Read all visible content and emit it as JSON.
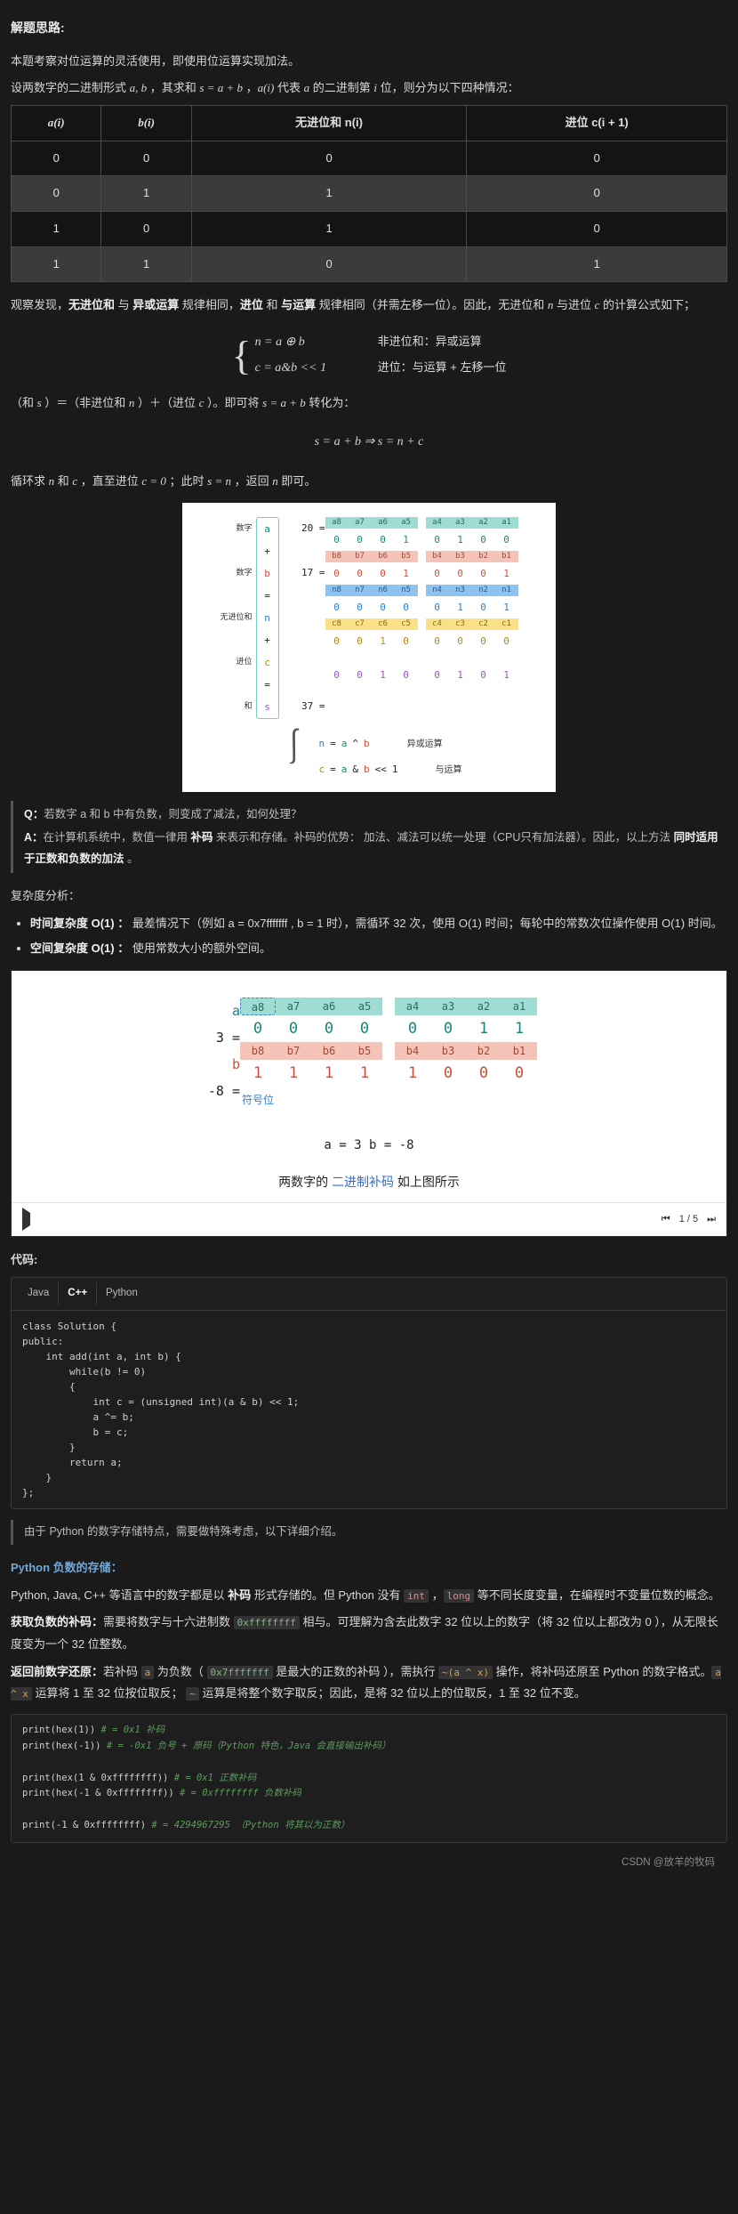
{
  "heading": "解题思路:",
  "intro1": "本题考察对位运算的灵活使用，即使用位运算实现加法。",
  "intro2_parts": {
    "p1": "设两数字的二进制形式 ",
    "m1": "a, b",
    "p2": " ，其求和 ",
    "m2": "s = a + b",
    "p3": " ，",
    "m3": "a(i)",
    "p4": " 代表 ",
    "m4": "a",
    "p5": " 的二进制第 ",
    "m5": "i",
    "p6": " 位，则分为以下四种情况："
  },
  "truth_table": {
    "headers": [
      "a(i)",
      "b(i)",
      "无进位和 n(i)",
      "进位 c(i + 1)"
    ],
    "rows": [
      [
        "0",
        "0",
        "0",
        "0"
      ],
      [
        "0",
        "1",
        "1",
        "0"
      ],
      [
        "1",
        "0",
        "1",
        "0"
      ],
      [
        "1",
        "1",
        "0",
        "1"
      ]
    ]
  },
  "observe_parts": {
    "p1": "观察发现，",
    "b1": "无进位和",
    "p2": " 与 ",
    "b2": "异或运算",
    "p3": " 规律相同，",
    "b3": "进位",
    "p4": " 和 ",
    "b4": "与运算",
    "p5": " 规律相同（并需左移一位）。因此，无进位和 ",
    "m1": "n",
    "p6": " 与进位 ",
    "m2": "c",
    "p7": " 的计算公式如下；"
  },
  "cases": [
    {
      "eq": "n = a ⊕ b",
      "comment": "非进位和：异或运算"
    },
    {
      "eq": "c = a&b << 1",
      "comment": "进位：与运算 + 左移一位"
    }
  ],
  "transform_parts": {
    "p1": "（和 ",
    "m1": "s",
    "p2": " ）＝（非进位和 ",
    "m2": "n",
    "p3": " ）＋（进位 ",
    "m3": "c",
    "p4": " ）。即可将 ",
    "m4": "s = a + b",
    "p5": " 转化为："
  },
  "center_eq": "s = a + b ⇒ s = n + c",
  "loop_parts": {
    "p1": "循环求 ",
    "m1": "n",
    "p2": " 和 ",
    "m2": "c",
    "p3": " ，直至进位 ",
    "m3": "c = 0",
    "p4": " ；此时 ",
    "m4": "s = n",
    "p5": " ，返回 ",
    "m5": "n",
    "p6": " 即可。"
  },
  "figure1": {
    "row_labels": [
      "数字",
      "",
      "数字",
      "",
      "无进位和",
      "",
      "进位",
      "",
      "和"
    ],
    "var_chars": [
      "a",
      "+",
      "b",
      "=",
      "n",
      "+",
      "c",
      "=",
      "s"
    ],
    "decimals": {
      "a": "20",
      "b": "17",
      "s": "37"
    },
    "eq_sign": "=",
    "bit_labels": {
      "a": [
        "a8",
        "a7",
        "a6",
        "a5",
        "a4",
        "a3",
        "a2",
        "a1"
      ],
      "b": [
        "b8",
        "b7",
        "b6",
        "b5",
        "b4",
        "b3",
        "b2",
        "b1"
      ],
      "n": [
        "n8",
        "n7",
        "n6",
        "n5",
        "n4",
        "n3",
        "n2",
        "n1"
      ],
      "c": [
        "c8",
        "c7",
        "c6",
        "c5",
        "c4",
        "c3",
        "c2",
        "c1"
      ]
    },
    "bit_values": {
      "a": [
        "0",
        "0",
        "0",
        "1",
        "0",
        "1",
        "0",
        "0"
      ],
      "b": [
        "0",
        "0",
        "0",
        "1",
        "0",
        "0",
        "0",
        "1"
      ],
      "n": [
        "0",
        "0",
        "0",
        "0",
        "0",
        "1",
        "0",
        "1"
      ],
      "c": [
        "0",
        "0",
        "1",
        "0",
        "0",
        "0",
        "0",
        "0"
      ],
      "s": [
        "0",
        "0",
        "1",
        "0",
        "0",
        "1",
        "0",
        "1"
      ]
    },
    "note_lines": [
      {
        "parts": [
          "n",
          "=",
          "a",
          "^",
          "b"
        ],
        "tail": "异或运算"
      },
      {
        "parts": [
          "c",
          "=",
          "a",
          "&",
          "b",
          "<<",
          "1"
        ],
        "tail": "与运算"
      }
    ]
  },
  "qa": {
    "q_label": "Q：",
    "q_text": "若数字 a 和 b 中有负数，则变成了减法，如何处理？",
    "a_label": "A：",
    "a_text_1": "在计算机系统中，数值一律用 ",
    "a_bold_1": "补码",
    "a_text_2": " 来表示和存储。补码的优势： 加法、减法可以统一处理（CPU只有加法器）。因此，以上方法 ",
    "a_bold_2": "同时适用于正数和负数的加法",
    "a_text_3": " 。"
  },
  "complexity": {
    "title": "复杂度分析：",
    "items": [
      {
        "bold": "时间复杂度 O(1) ：",
        "text": " 最差情况下（例如 a = 0x7fffffff , b = 1 时），需循环 32 次，使用 O(1) 时间；每轮中的常数次位操作使用 O(1) 时间。"
      },
      {
        "bold": "空间复杂度 O(1) ：",
        "text": " 使用常数大小的额外空间。"
      }
    ]
  },
  "figure2": {
    "var_a": "a",
    "var_b": "b",
    "dec_a": "3",
    "dec_b": "-8",
    "eq": "=",
    "labels_a": [
      "a8",
      "a7",
      "a6",
      "a5",
      "a4",
      "a3",
      "a2",
      "a1"
    ],
    "labels_b": [
      "b8",
      "b7",
      "b6",
      "b5",
      "b4",
      "b3",
      "b2",
      "b1"
    ],
    "values_a": [
      "0",
      "0",
      "0",
      "0",
      "0",
      "0",
      "1",
      "1"
    ],
    "values_b": [
      "1",
      "1",
      "1",
      "1",
      "1",
      "0",
      "0",
      "0"
    ],
    "sign_label": "符号位",
    "caption_line1": "a = 3      b = -8",
    "caption_prefix": "两数字的 ",
    "caption_link": "二进制补码",
    "caption_suffix": " 如上图所示",
    "page_indicator": "1 / 5"
  },
  "code_section": {
    "title": "代码:",
    "tabs": [
      "Java",
      "C++",
      "Python"
    ],
    "active_tab": "C++",
    "code": "class Solution {\npublic:\n    int add(int a, int b) {\n        while(b != 0)\n        {\n            int c = (unsigned int)(a & b) << 1;\n            a ^= b;\n            b = c;\n        }\n        return a;\n    }\n};"
  },
  "python_note": "由于 Python 的数字存储特点，需要做特殊考虑，以下详细介绍。",
  "python_section": {
    "title": "Python 负数的存储：",
    "p1_a": "Python, Java, C++ 等语言中的数字都是以 ",
    "p1_b": "补码",
    "p1_c": " 形式存储的。但 Python 没有 ",
    "p1_code1": "int",
    "p1_d": " ，",
    "p1_code2": "long",
    "p1_e": " 等不同长度变量，在编程时不变量位数的概念。",
    "h1": "获取负数的补码：",
    "t1_a": "需要将数字与十六进制数 ",
    "t1_code": "0xffffffff",
    "t1_b": " 相与。可理解为含去此数字 32 位以上的数字（将 32 位以上都改为 0 ），从无限长度变为一个 32 位整数。",
    "h2": "返回前数字还原：",
    "t2_a": "若补码 ",
    "t2_code1": "a",
    "t2_b": " 为负数（ ",
    "t2_code2": "0x7fffffff",
    "t2_c": " 是最大的正数的补码 ），需执行 ",
    "t2_code3": "~(a ^ x)",
    "t2_d": " 操作，将补码还原至 Python 的数字格式。",
    "t2_code4": "a ^ x",
    "t2_e": " 运算将 1 至 32 位按位取反； ",
    "t2_code5": "~",
    "t2_f": " 运算是将整个数字取反；因此，是将 32 位以上的位取反，1 至 32 位不变。"
  },
  "example_code": [
    {
      "code": "print(hex(1))",
      "comment": "# = 0x1 补码"
    },
    {
      "code": "print(hex(-1))",
      "comment": "# = -0x1 负号 + 原码（Python 特色，Java 会直接输出补码）"
    },
    {
      "code": "",
      "comment": ""
    },
    {
      "code": "print(hex(1 & 0xffffffff))",
      "comment": "# = 0x1 正数补码"
    },
    {
      "code": "print(hex(-1 & 0xffffffff))",
      "comment": "# = 0xffffffff 负数补码"
    },
    {
      "code": "",
      "comment": ""
    },
    {
      "code": "print(-1 & 0xffffffff)",
      "comment": "# = 4294967295 （Python 将其以为正数）"
    }
  ],
  "watermark": "CSDN @放羊的牧码"
}
